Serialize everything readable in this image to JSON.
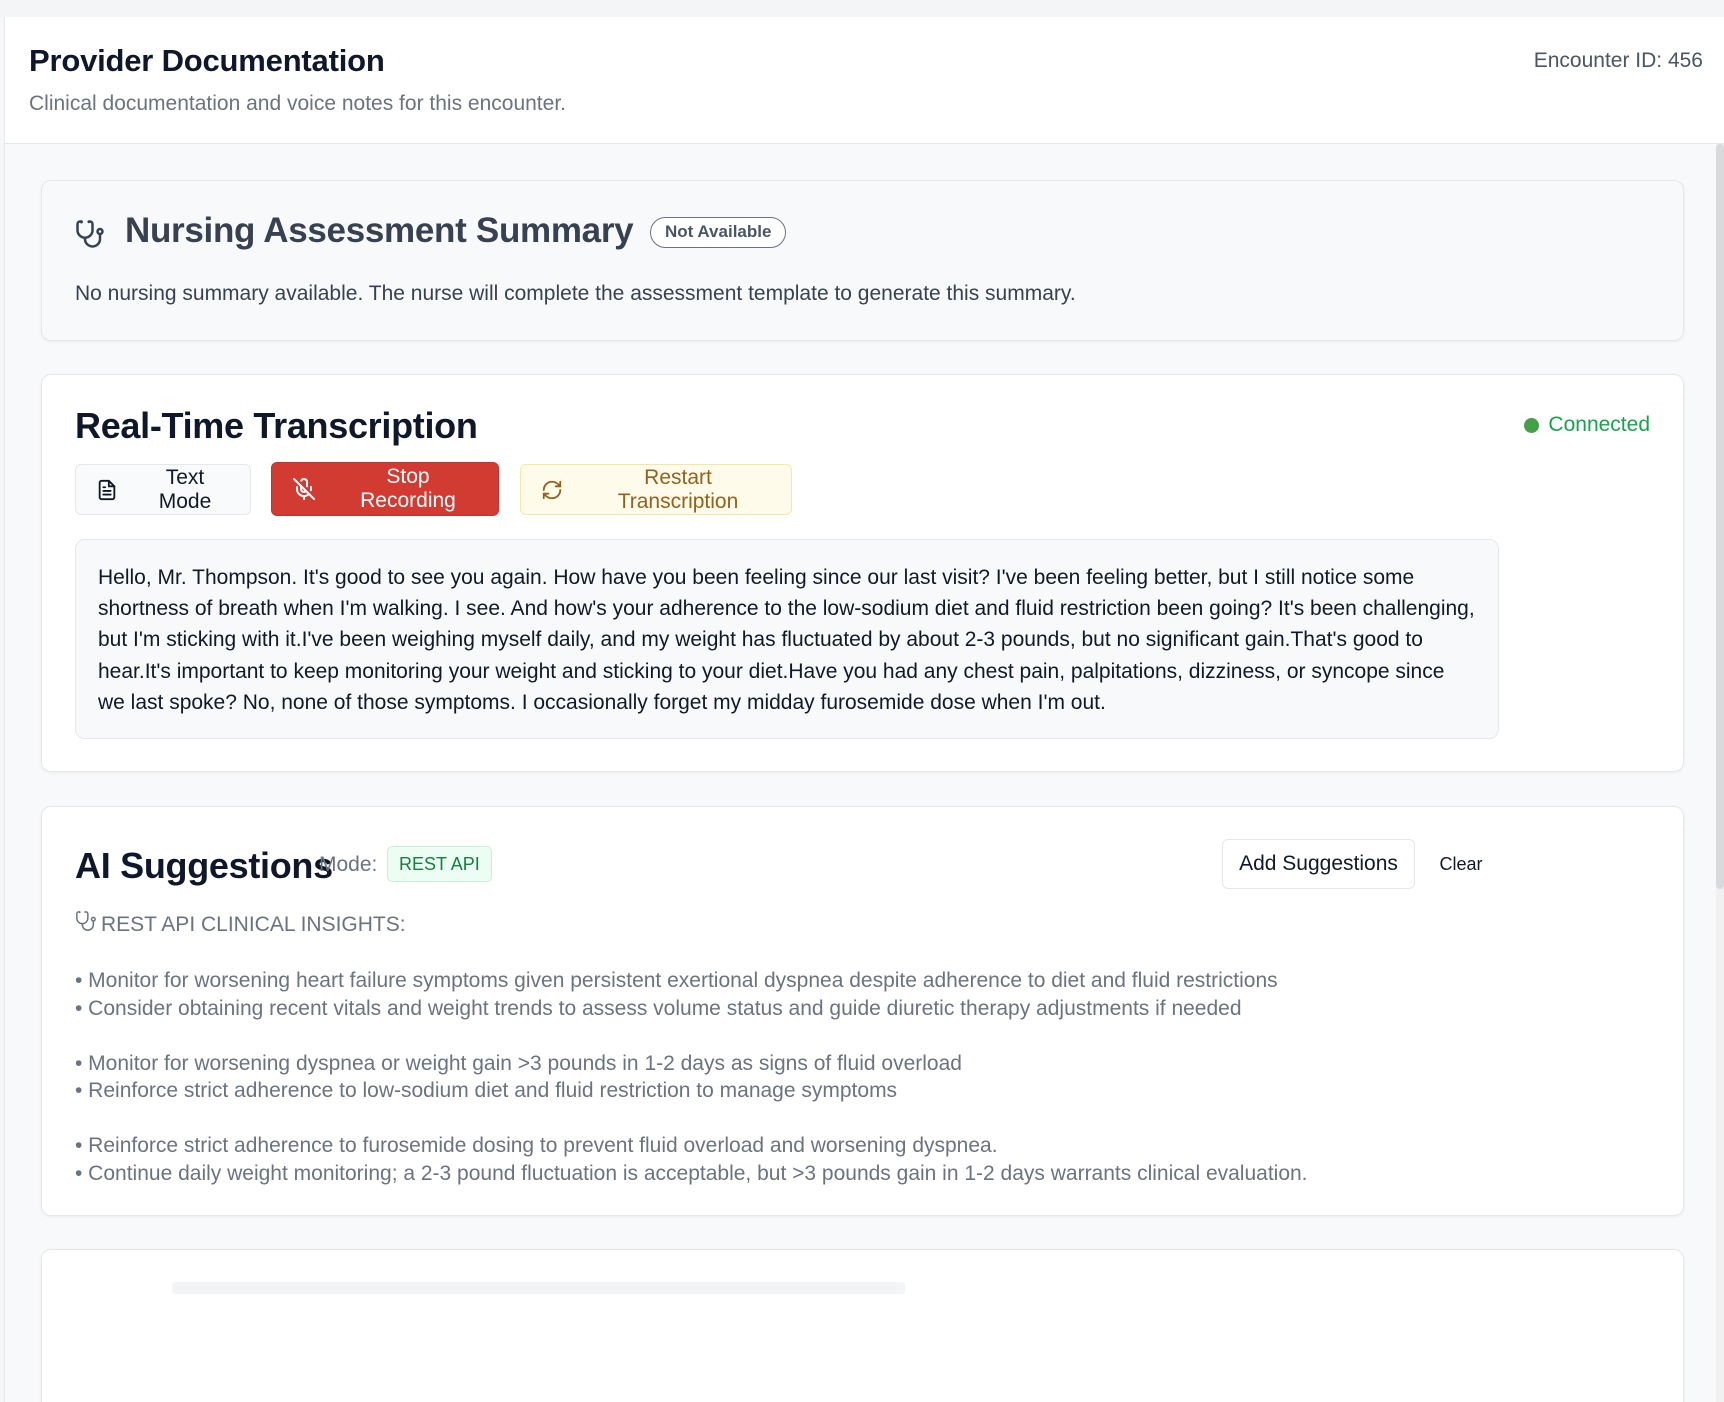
{
  "header": {
    "title": "Provider Documentation",
    "subtitle": "Clinical documentation and voice notes for this encounter.",
    "encounter_id": "Encounter ID: 456"
  },
  "nursing": {
    "icon": "stethoscope-icon",
    "title": "Nursing Assessment Summary",
    "badge": "Not Available",
    "message": "No nursing summary available. The nurse will complete the assessment template to generate this summary."
  },
  "transcription": {
    "title": "Real-Time Transcription",
    "status": "Connected",
    "status_color": "#43a047",
    "buttons": {
      "text_mode": "Text Mode",
      "stop_recording": "Stop Recording",
      "restart": "Restart Transcription"
    },
    "text": "Hello, Mr. Thompson. It's good to see you again. How have you been feeling since our last visit? I've been feeling better, but I still notice some shortness of breath when I'm walking. I see. And how's your adherence to the low-sodium diet and fluid restriction been going? It's been challenging, but I'm sticking with it.I've been weighing myself daily, and my weight has fluctuated by about 2-3 pounds, but no significant gain.That's good to hear.It's important to keep monitoring your weight and sticking to your diet.Have you had any chest pain, palpitations, dizziness, or syncope since we last spoke? No, none of those symptoms. I occasionally forget my midday furosemide dose when I'm out."
  },
  "ai": {
    "title": "AI Suggestions",
    "mode_label": "Mode:",
    "mode_value": "REST API",
    "add_button": "Add Suggestions",
    "clear_button": "Clear",
    "insights_header": "REST API CLINICAL INSIGHTS:",
    "groups": [
      [
        "• Monitor for worsening heart failure symptoms given persistent exertional dyspnea despite adherence to diet and fluid restrictions",
        "• Consider obtaining recent vitals and weight trends to assess volume status and guide diuretic therapy adjustments if needed"
      ],
      [
        "• Monitor for worsening dyspnea or weight gain >3 pounds in 1-2 days as signs of fluid overload",
        "• Reinforce strict adherence to low-sodium diet and fluid restriction to manage symptoms"
      ],
      [
        "• Reinforce strict adherence to furosemide dosing to prevent fluid overload and worsening dyspnea.",
        "• Continue daily weight monitoring; a 2-3 pound fluctuation is acceptable, but >3 pounds gain in 1-2 days warrants clinical evaluation."
      ]
    ]
  },
  "colors": {
    "stop_button": "#d13b32",
    "restart_button_bg": "#fffbea",
    "restart_button_text": "#92621c",
    "connected": "#16a34a",
    "mode_badge_bg": "#ecfdf3",
    "mode_badge_text": "#15803d"
  }
}
